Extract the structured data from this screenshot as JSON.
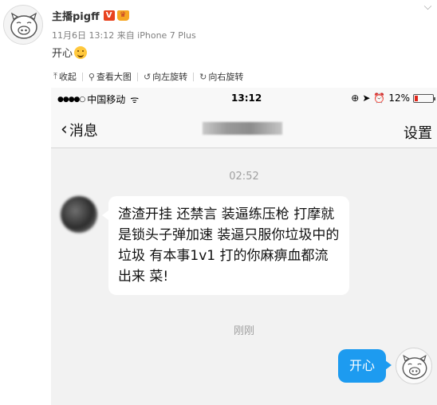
{
  "post": {
    "username": "主播pigff",
    "vip_badge": "V",
    "crown_badge": "♛",
    "meta": "11月6日 13:12 来自 iPhone 7 Plus",
    "text": "开心"
  },
  "toolbar": {
    "collapse": "收起",
    "view_large": "查看大图",
    "rotate_left": "向左旋转",
    "rotate_right": "向右旋转"
  },
  "phone": {
    "status": {
      "signal": "●●●●○",
      "carrier": "中国移动",
      "wifi": "ᯤ",
      "time": "13:12",
      "battery": "12%"
    },
    "nav": {
      "back": "消息",
      "right": "设置"
    },
    "messages": {
      "time1": "02:52",
      "incoming": "渣渣开挂 还禁言  装逼练压枪  打摩就是锁头子弹加速 装逼只服你垃圾中的垃圾  有本事1v1 打的你麻痹血都流出来 菜!",
      "time2": "刚刚",
      "outgoing": "开心"
    }
  },
  "colors": {
    "bubble_out": "#1d9bf0",
    "chat_bg": "#f2f2f2",
    "battery_low": "#e0261a"
  }
}
